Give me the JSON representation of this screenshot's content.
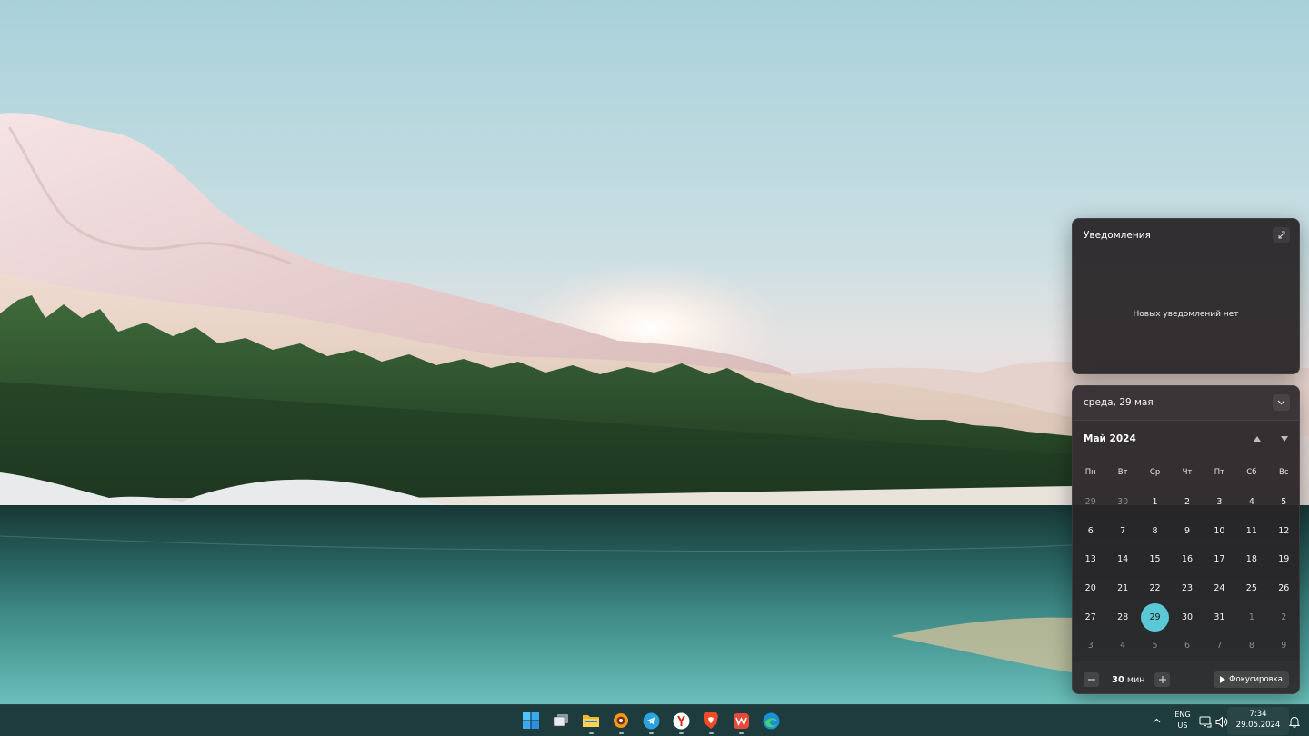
{
  "notifications": {
    "title": "Уведомления",
    "empty_text": "Новых уведомлений нет"
  },
  "calendar": {
    "date_label": "среда, 29 мая",
    "month_label": "Май 2024",
    "weekdays": [
      "Пн",
      "Вт",
      "Ср",
      "Чт",
      "Пт",
      "Сб",
      "Вс"
    ],
    "days": [
      {
        "d": "29",
        "muted": true
      },
      {
        "d": "30",
        "muted": true
      },
      {
        "d": "1"
      },
      {
        "d": "2"
      },
      {
        "d": "3"
      },
      {
        "d": "4"
      },
      {
        "d": "5"
      },
      {
        "d": "6"
      },
      {
        "d": "7"
      },
      {
        "d": "8"
      },
      {
        "d": "9"
      },
      {
        "d": "10"
      },
      {
        "d": "11"
      },
      {
        "d": "12"
      },
      {
        "d": "13"
      },
      {
        "d": "14"
      },
      {
        "d": "15"
      },
      {
        "d": "16"
      },
      {
        "d": "17"
      },
      {
        "d": "18"
      },
      {
        "d": "19"
      },
      {
        "d": "20"
      },
      {
        "d": "21"
      },
      {
        "d": "22"
      },
      {
        "d": "23"
      },
      {
        "d": "24"
      },
      {
        "d": "25"
      },
      {
        "d": "26"
      },
      {
        "d": "27"
      },
      {
        "d": "28"
      },
      {
        "d": "29",
        "today": true
      },
      {
        "d": "30"
      },
      {
        "d": "31"
      },
      {
        "d": "1",
        "muted": true
      },
      {
        "d": "2",
        "muted": true
      },
      {
        "d": "3",
        "muted": true
      },
      {
        "d": "4",
        "muted": true
      },
      {
        "d": "5",
        "muted": true
      },
      {
        "d": "6",
        "muted": true
      },
      {
        "d": "7",
        "muted": true
      },
      {
        "d": "8",
        "muted": true
      },
      {
        "d": "9",
        "muted": true
      }
    ],
    "today_color": "#5bc8d6"
  },
  "focus": {
    "minutes": "30",
    "unit": "мин",
    "button_label": "Фокусировка"
  },
  "taskbar": {
    "apps": [
      "start-icon",
      "task-view-icon",
      "file-explorer-icon",
      "xnview-icon",
      "telegram-icon",
      "yandex-browser-icon",
      "brave-browser-icon",
      "wps-office-icon",
      "edge-browser-icon"
    ],
    "language": "ENG",
    "region": "US",
    "time": "7:34",
    "date": "29.05.2024"
  }
}
